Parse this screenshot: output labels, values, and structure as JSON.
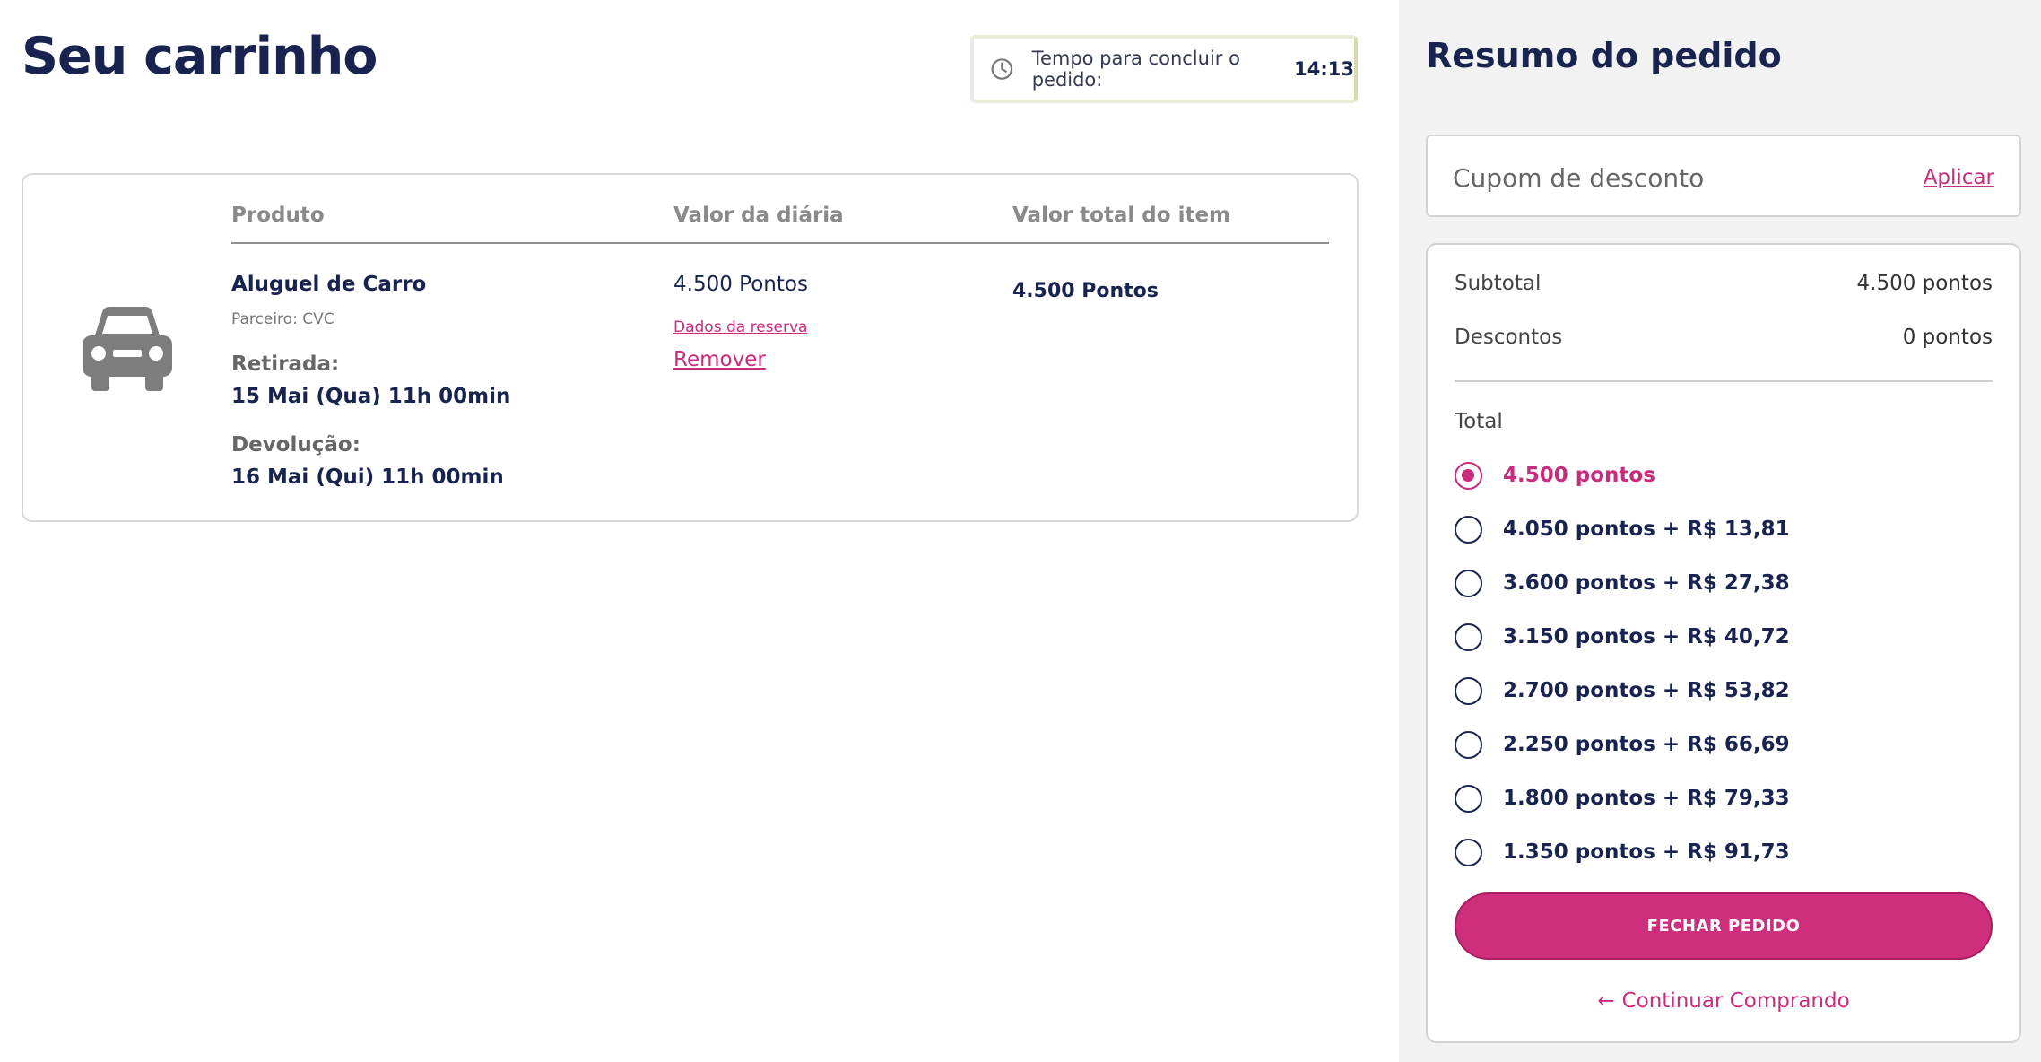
{
  "cart": {
    "title": "Seu carrinho",
    "timer": {
      "label": "Tempo para concluir o pedido:",
      "time": "14:13"
    },
    "columns": {
      "product": "Produto",
      "daily": "Valor da diária",
      "total": "Valor total do item"
    },
    "item": {
      "name": "Aluguel de Carro",
      "partner": "Parceiro: CVC",
      "pickup_label": "Retirada:",
      "pickup_value": "15 Mai (Qua) 11h 00min",
      "return_label": "Devolução:",
      "return_value": "16 Mai (Qui) 11h 00min",
      "daily_value": "4.500 Pontos",
      "reservation_link": "Dados da reserva",
      "remove_link": "Remover",
      "total_value": "4.500 Pontos"
    }
  },
  "summary": {
    "title": "Resumo do pedido",
    "coupon": {
      "placeholder": "Cupom de desconto",
      "apply": "Aplicar"
    },
    "subtotal_label": "Subtotal",
    "subtotal_value": "4.500 pontos",
    "discount_label": "Descontos",
    "discount_value": "0 pontos",
    "total_label": "Total",
    "options": [
      {
        "label": "4.500 pontos",
        "selected": true
      },
      {
        "label": "4.050 pontos + R$ 13,81",
        "selected": false
      },
      {
        "label": "3.600 pontos + R$ 27,38",
        "selected": false
      },
      {
        "label": "3.150 pontos + R$ 40,72",
        "selected": false
      },
      {
        "label": "2.700 pontos + R$ 53,82",
        "selected": false
      },
      {
        "label": "2.250 pontos + R$ 66,69",
        "selected": false
      },
      {
        "label": "1.800 pontos + R$ 79,33",
        "selected": false
      },
      {
        "label": "1.350 pontos + R$ 91,73",
        "selected": false
      }
    ],
    "checkout_button": "FECHAR PEDIDO",
    "continue_arrow": "←",
    "continue_link": "Continuar Comprando"
  },
  "icons": {
    "timer": "clock-icon",
    "product": "car-icon",
    "back": "arrow-left-icon"
  },
  "colors": {
    "accent": "#ce2e7b",
    "navy": "#18244f",
    "summary_bg": "#f2f2f2"
  }
}
